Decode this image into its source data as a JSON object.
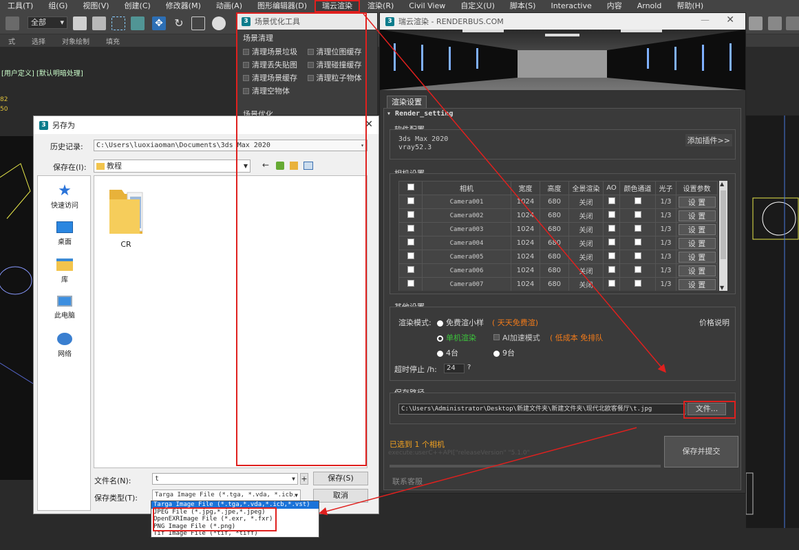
{
  "menubar": {
    "items": [
      "工具(T)",
      "组(G)",
      "视图(V)",
      "创建(C)",
      "修改器(M)",
      "动画(A)",
      "图形编辑器(D)",
      "瑞云渲染",
      "渲染(R)",
      "Civil View",
      "自定义(U)",
      "脚本(S)",
      "Interactive",
      "内容",
      "Arnold",
      "帮助(H)"
    ]
  },
  "toolbar": {
    "selection_filter": "全部"
  },
  "ribbon": {
    "items": [
      "式",
      "选择",
      "对象绘制",
      "填充"
    ]
  },
  "viewport": {
    "label": "[用户定义] [默认明暗处理]",
    "stat1": "82",
    "stat2": "50"
  },
  "scene_tool": {
    "title": "场景优化工具",
    "section_clean": "场景清理",
    "clean_items": [
      "清理场景垃圾",
      "清理位图缓存",
      "清理丢失贴图",
      "清理碰撞缓存",
      "清理场景缓存",
      "清理粒子物体",
      "清理空物体"
    ],
    "section_optimize": "场景优化"
  },
  "render": {
    "title": "瑞云渲染 - RENDERBUS.COM",
    "tab": "渲染设置",
    "panel_title": "Render_setting",
    "software": {
      "label": "软件配置",
      "app": "3ds Max 2020",
      "renderer": "vray52.3",
      "add_plugin": "添加插件>>"
    },
    "camera": {
      "label": "相机设置",
      "headers": [
        "相机",
        "宽度",
        "高度",
        "全景渲染",
        "AO",
        "颜色通道",
        "光子",
        "设置参数"
      ],
      "rows": [
        {
          "name": "Camera001",
          "w": "1024",
          "h": "680",
          "pano": "关闭",
          "photon": "1/3",
          "btn": "设 置"
        },
        {
          "name": "Camera002",
          "w": "1024",
          "h": "680",
          "pano": "关闭",
          "photon": "1/3",
          "btn": "设 置"
        },
        {
          "name": "Camera003",
          "w": "1024",
          "h": "680",
          "pano": "关闭",
          "photon": "1/3",
          "btn": "设 置"
        },
        {
          "name": "Camera004",
          "w": "1024",
          "h": "680",
          "pano": "关闭",
          "photon": "1/3",
          "btn": "设 置"
        },
        {
          "name": "Camera005",
          "w": "1024",
          "h": "680",
          "pano": "关闭",
          "photon": "1/3",
          "btn": "设 置"
        },
        {
          "name": "Camera006",
          "w": "1024",
          "h": "680",
          "pano": "关闭",
          "photon": "1/3",
          "btn": "设 置"
        },
        {
          "name": "Camera007",
          "w": "1024",
          "h": "680",
          "pano": "关闭",
          "photon": "1/3",
          "btn": "设 置"
        }
      ]
    },
    "other": {
      "label": "其他设置",
      "mode_label": "渲染模式:",
      "opt_free": "免费渲小样",
      "free_note": "( 天天免费渲)",
      "price": "价格说明",
      "opt_single": "单机渲染",
      "ai": "AI加速模式",
      "ai_note": "( 低成本 免排队",
      "opt_4": "4台",
      "opt_9": "9台",
      "timeout_label": "超时停止 /h:",
      "timeout": "24",
      "help": "?"
    },
    "save": {
      "label": "保存路径",
      "path": "C:\\Users\\Administrator\\Desktop\\新建文件夹\\新建文件夹\\现代北欧客餐厅\\t.jpg",
      "file_btn": "文件..."
    },
    "status": "已选到 1 个相机",
    "log": "execute:userC++API[\"releaseVersion\" \"5.1.0\"",
    "submit": "保存并提交",
    "contact": "联系客服"
  },
  "saveas": {
    "title": "另存为",
    "history_label": "历史记录:",
    "history": "C:\\Users\\luoxiaoman\\Documents\\3ds Max 2020",
    "savein_label": "保存在(I):",
    "savein": "教程",
    "places": [
      "快速访问",
      "桌面",
      "库",
      "此电脑",
      "网络"
    ],
    "folder": "CR",
    "filename_label": "文件名(N):",
    "filename": "t",
    "plus": "+",
    "filetype_label": "保存类型(T):",
    "filetype": "Targa Image File (*.tga, *.vda, *.icb, *.vst)",
    "save_btn": "保存(S)",
    "cancel_btn": "取消",
    "type_options": [
      "Targa Image File (*.tga,*.vda,*.icb,*.vst)",
      "JPEG File (*.jpg,*.jpe,*.jpeg)",
      "OpenEXRImage File (*.exr, *.fxr)",
      "PNG Image File (*.png)",
      "Tif Image File (*tif, *tiff)"
    ]
  },
  "colors": {
    "accent_red": "#e0201e",
    "orange": "#f07a1a",
    "green": "#3cc43c"
  }
}
